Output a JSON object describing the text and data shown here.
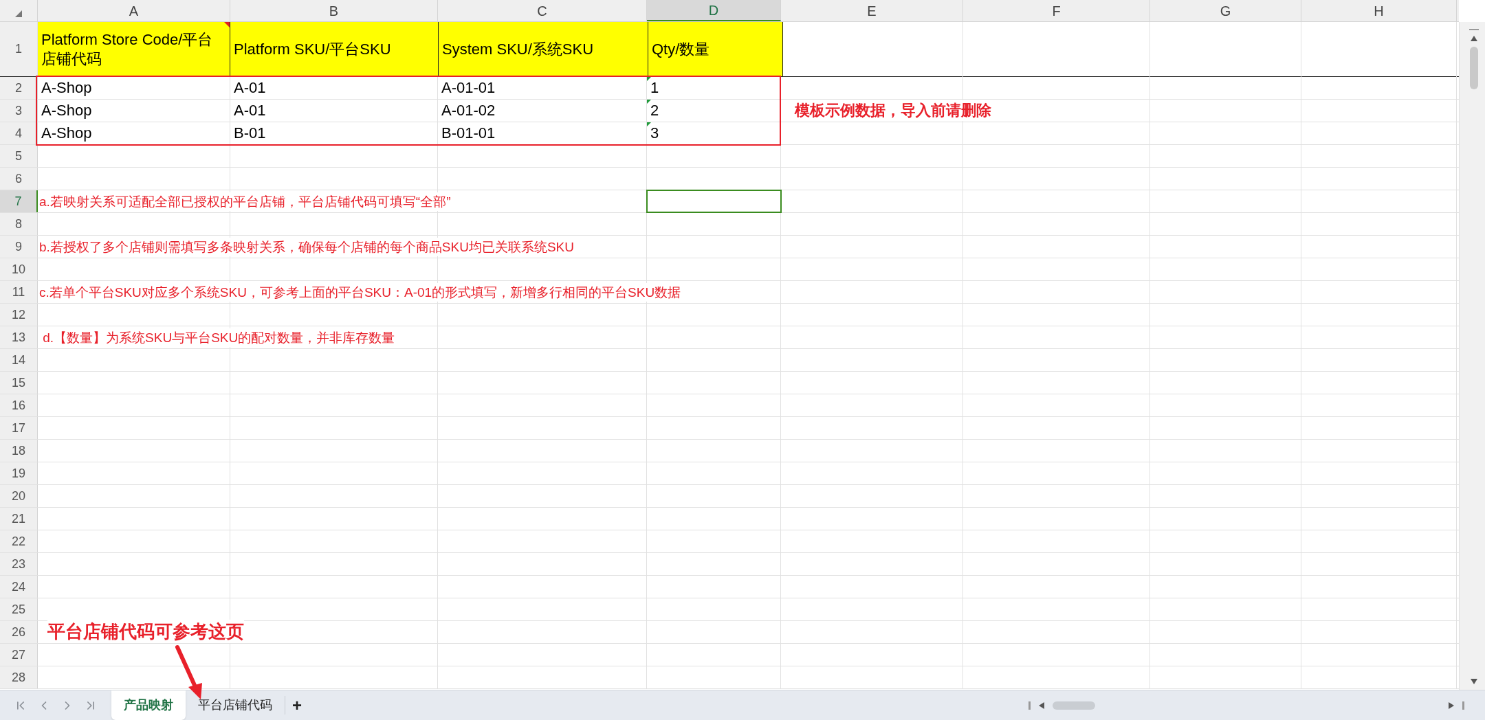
{
  "columns": [
    {
      "label": "A",
      "selected": false
    },
    {
      "label": "B",
      "selected": false
    },
    {
      "label": "C",
      "selected": false
    },
    {
      "label": "D",
      "selected": true
    },
    {
      "label": "E",
      "selected": false
    },
    {
      "label": "F",
      "selected": false
    },
    {
      "label": "G",
      "selected": false
    },
    {
      "label": "H",
      "selected": false
    }
  ],
  "rows": [
    {
      "number": "1",
      "selected": false,
      "kind": "header",
      "cells": [
        {
          "text": "Platform Store Code/平台店铺代码",
          "comment": true
        },
        {
          "text": "Platform SKU/平台SKU",
          "comment": false
        },
        {
          "text": "System SKU/系统SKU",
          "comment": false
        },
        {
          "text": "Qty/数量",
          "comment": false
        }
      ]
    },
    {
      "number": "2",
      "selected": false,
      "kind": "data",
      "cells": [
        {
          "text": "A-Shop",
          "flagged": false
        },
        {
          "text": "A-01",
          "flagged": false
        },
        {
          "text": "A-01-01",
          "flagged": false
        },
        {
          "text": "1",
          "flagged": true
        }
      ]
    },
    {
      "number": "3",
      "selected": false,
      "kind": "data",
      "side_note": "模板示例数据，导入前请删除",
      "cells": [
        {
          "text": "A-Shop",
          "flagged": false
        },
        {
          "text": "A-01",
          "flagged": false
        },
        {
          "text": "A-01-02",
          "flagged": false
        },
        {
          "text": "2",
          "flagged": true
        }
      ]
    },
    {
      "number": "4",
      "selected": false,
      "kind": "data",
      "cells": [
        {
          "text": "A-Shop",
          "flagged": false
        },
        {
          "text": "B-01",
          "flagged": false
        },
        {
          "text": "B-01-01",
          "flagged": false
        },
        {
          "text": "3",
          "flagged": true
        }
      ]
    },
    {
      "number": "5",
      "selected": false,
      "kind": "empty"
    },
    {
      "number": "6",
      "selected": false,
      "kind": "empty"
    },
    {
      "number": "7",
      "selected": true,
      "kind": "note",
      "note": "a.若映射关系可适配全部已授权的平台店铺，平台店铺代码可填写“全部”"
    },
    {
      "number": "8",
      "selected": false,
      "kind": "empty"
    },
    {
      "number": "9",
      "selected": false,
      "kind": "note",
      "note": "b.若授权了多个店铺则需填写多条映射关系，确保每个店铺的每个商品SKU均已关联系统SKU"
    },
    {
      "number": "10",
      "selected": false,
      "kind": "empty"
    },
    {
      "number": "11",
      "selected": false,
      "kind": "note",
      "note": "c.若单个平台SKU对应多个系统SKU，可参考上面的平台SKU：A-01的形式填写，新增多行相同的平台SKU数据"
    },
    {
      "number": "12",
      "selected": false,
      "kind": "empty"
    },
    {
      "number": "13",
      "selected": false,
      "kind": "note",
      "note": " d.【数量】为系统SKU与平台SKU的配对数量，并非库存数量"
    },
    {
      "number": "14",
      "selected": false,
      "kind": "empty"
    },
    {
      "number": "15",
      "selected": false,
      "kind": "empty"
    },
    {
      "number": "16",
      "selected": false,
      "kind": "empty"
    },
    {
      "number": "17",
      "selected": false,
      "kind": "empty"
    },
    {
      "number": "18",
      "selected": false,
      "kind": "empty"
    },
    {
      "number": "19",
      "selected": false,
      "kind": "empty"
    },
    {
      "number": "20",
      "selected": false,
      "kind": "empty"
    },
    {
      "number": "21",
      "selected": false,
      "kind": "empty"
    },
    {
      "number": "22",
      "selected": false,
      "kind": "empty"
    },
    {
      "number": "23",
      "selected": false,
      "kind": "empty"
    },
    {
      "number": "24",
      "selected": false,
      "kind": "empty"
    },
    {
      "number": "25",
      "selected": false,
      "kind": "empty"
    },
    {
      "number": "26",
      "selected": false,
      "kind": "callout",
      "note": "平台店铺代码可参考这页"
    },
    {
      "number": "27",
      "selected": false,
      "kind": "empty"
    },
    {
      "number": "28",
      "selected": false,
      "kind": "empty"
    }
  ],
  "sheet_tabs": [
    {
      "label": "产品映射",
      "selected": true
    },
    {
      "label": "平台店铺代码",
      "selected": false
    }
  ],
  "add_sheet": "+"
}
